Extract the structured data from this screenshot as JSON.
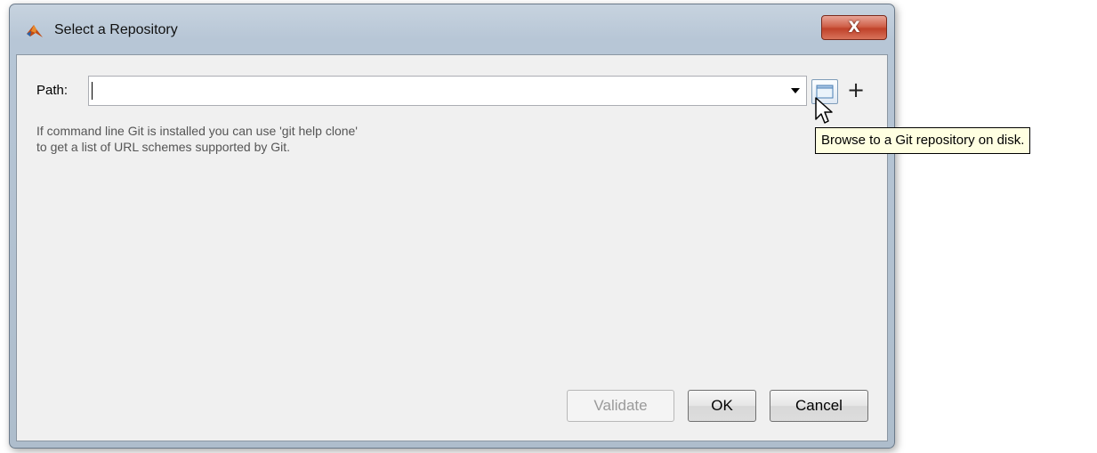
{
  "window": {
    "title": "Select a Repository",
    "close_label": "X"
  },
  "path": {
    "label": "Path:",
    "value": "",
    "placeholder": ""
  },
  "help": {
    "line1": "If command line Git is installed you can use 'git help clone'",
    "line2": "to get a list of URL schemes supported by Git."
  },
  "buttons": {
    "validate": "Validate",
    "ok": "OK",
    "cancel": "Cancel",
    "add": "+"
  },
  "tooltip": {
    "text": "Browse to a Git repository on disk."
  },
  "icons": {
    "app": "matlab-icon",
    "dropdown": "chevron-down-icon",
    "browse": "folder-icon",
    "add": "plus-icon",
    "cursor": "arrow-cursor-icon",
    "close": "close-icon"
  },
  "colors": {
    "tooltip_bg": "#ffffe1",
    "close_button": "#c0422a",
    "dialog_bg": "#f0f0f0"
  }
}
